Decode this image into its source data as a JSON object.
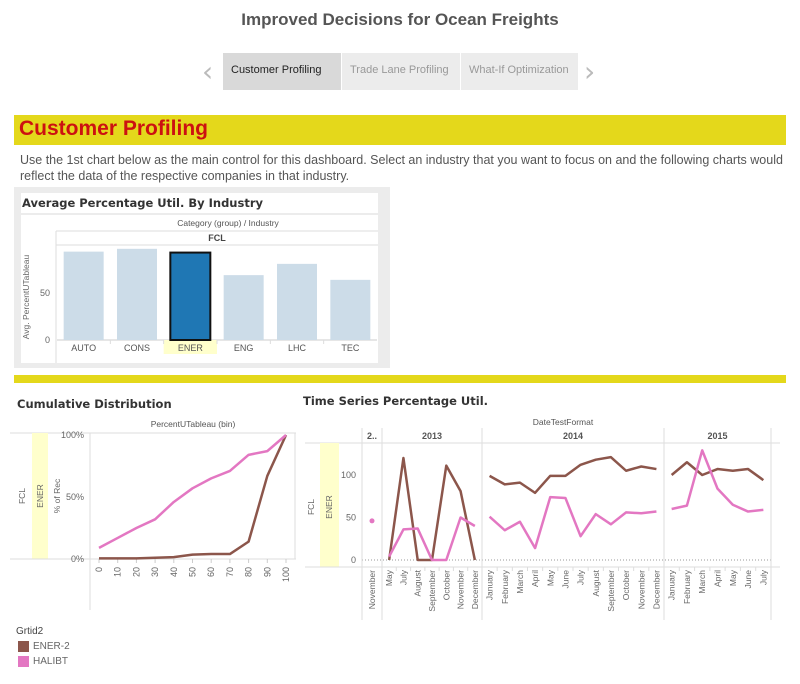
{
  "header": {
    "title": "Improved Decisions for Ocean Freights",
    "prev_icon": "chevron-left-icon",
    "next_icon": "chevron-right-icon",
    "tabs": [
      {
        "label": "Customer Profiling",
        "active": true
      },
      {
        "label": "Trade Lane Profiling",
        "active": false
      },
      {
        "label": "What-If Optimization",
        "active": false
      }
    ]
  },
  "section": {
    "title": "Customer Profiling",
    "description": "Use the 1st chart below as the main control for this dashboard. Select an industry that you want to focus on and the following charts would reflect the data of the respective companies in that industry."
  },
  "colors": {
    "banner": "#e4d81b",
    "banner_text": "#cc1111",
    "bar_default": "#ccdce8",
    "bar_selected": "#1f77b4",
    "highlight": "#ffffcc",
    "series_ener2": "#8c564b",
    "series_halibt": "#e377c2"
  },
  "legend": {
    "title": "Grtid2",
    "items": [
      {
        "label": "ENER-2",
        "color": "#8c564b"
      },
      {
        "label": "HALIBT",
        "color": "#e377c2"
      }
    ]
  },
  "chart_data": [
    {
      "id": "industry",
      "type": "bar",
      "title": "Average Percentage Util. By Industry",
      "header": "Category (group)  /  Industry",
      "group": "FCL",
      "ylabel": "Avg. PercentUTableau",
      "ylim": [
        0,
        100
      ],
      "yticks": [
        0,
        50
      ],
      "categories": [
        "AUTO",
        "CONS",
        "ENER",
        "ENG",
        "LHC",
        "TEC"
      ],
      "values": [
        94,
        97,
        93,
        69,
        81,
        64
      ],
      "selected": "ENER"
    },
    {
      "id": "cumulative",
      "type": "line",
      "title": "Cumulative Distribution",
      "xlabel": "PercentUTableau (bin)",
      "ylabel": "% of Rec",
      "row_labels": [
        "FCL",
        "ENER"
      ],
      "ylim": [
        0,
        100
      ],
      "yticks": [
        "0%",
        "50%",
        "100%"
      ],
      "x": [
        0,
        10,
        20,
        30,
        40,
        50,
        60,
        70,
        80,
        90,
        100
      ],
      "series": [
        {
          "name": "ENER-2",
          "values": [
            0.5,
            0.5,
            0.5,
            1,
            1.5,
            3.5,
            4,
            4,
            14,
            67,
            100
          ]
        },
        {
          "name": "HALIBT",
          "values": [
            9,
            17,
            25,
            32,
            46,
            57,
            65,
            71,
            84,
            87,
            100
          ]
        }
      ]
    },
    {
      "id": "timeseries",
      "type": "line",
      "title": "Time Series Percentage Util.",
      "xlabel": "DateTestFormat",
      "row_labels": [
        "FCL",
        "ENER"
      ],
      "ylim": [
        0,
        130
      ],
      "yticks": [
        0,
        50,
        100
      ],
      "years": [
        {
          "label": "2..",
          "months": [
            "November"
          ],
          "series": [
            {
              "name": "ENER-2",
              "values": [
                null
              ]
            },
            {
              "name": "HALIBT",
              "values": [
                46
              ]
            }
          ]
        },
        {
          "label": "2013",
          "months": [
            "May",
            "July",
            "August",
            "September",
            "October",
            "November",
            "December"
          ],
          "series": [
            {
              "name": "ENER-2",
              "values": [
                0,
                120,
                0,
                0,
                111,
                81,
                0
              ]
            },
            {
              "name": "HALIBT",
              "values": [
                4,
                36,
                37,
                0,
                0,
                50,
                40
              ]
            }
          ]
        },
        {
          "label": "2014",
          "months": [
            "January",
            "February",
            "March",
            "April",
            "May",
            "June",
            "July",
            "August",
            "September",
            "October",
            "November",
            "December"
          ],
          "series": [
            {
              "name": "ENER-2",
              "values": [
                99,
                89,
                91,
                79,
                99,
                99,
                112,
                118,
                121,
                105,
                110,
                107
              ]
            },
            {
              "name": "HALIBT",
              "values": [
                51,
                35,
                45,
                14,
                74,
                73,
                28,
                54,
                42,
                56,
                55,
                57
              ]
            }
          ]
        },
        {
          "label": "2015",
          "months": [
            "January",
            "February",
            "March",
            "April",
            "May",
            "June",
            "July"
          ],
          "series": [
            {
              "name": "ENER-2",
              "values": [
                100,
                115,
                100,
                107,
                105,
                107,
                94
              ]
            },
            {
              "name": "HALIBT",
              "values": [
                60,
                64,
                129,
                84,
                65,
                57,
                59
              ]
            }
          ]
        }
      ]
    }
  ]
}
